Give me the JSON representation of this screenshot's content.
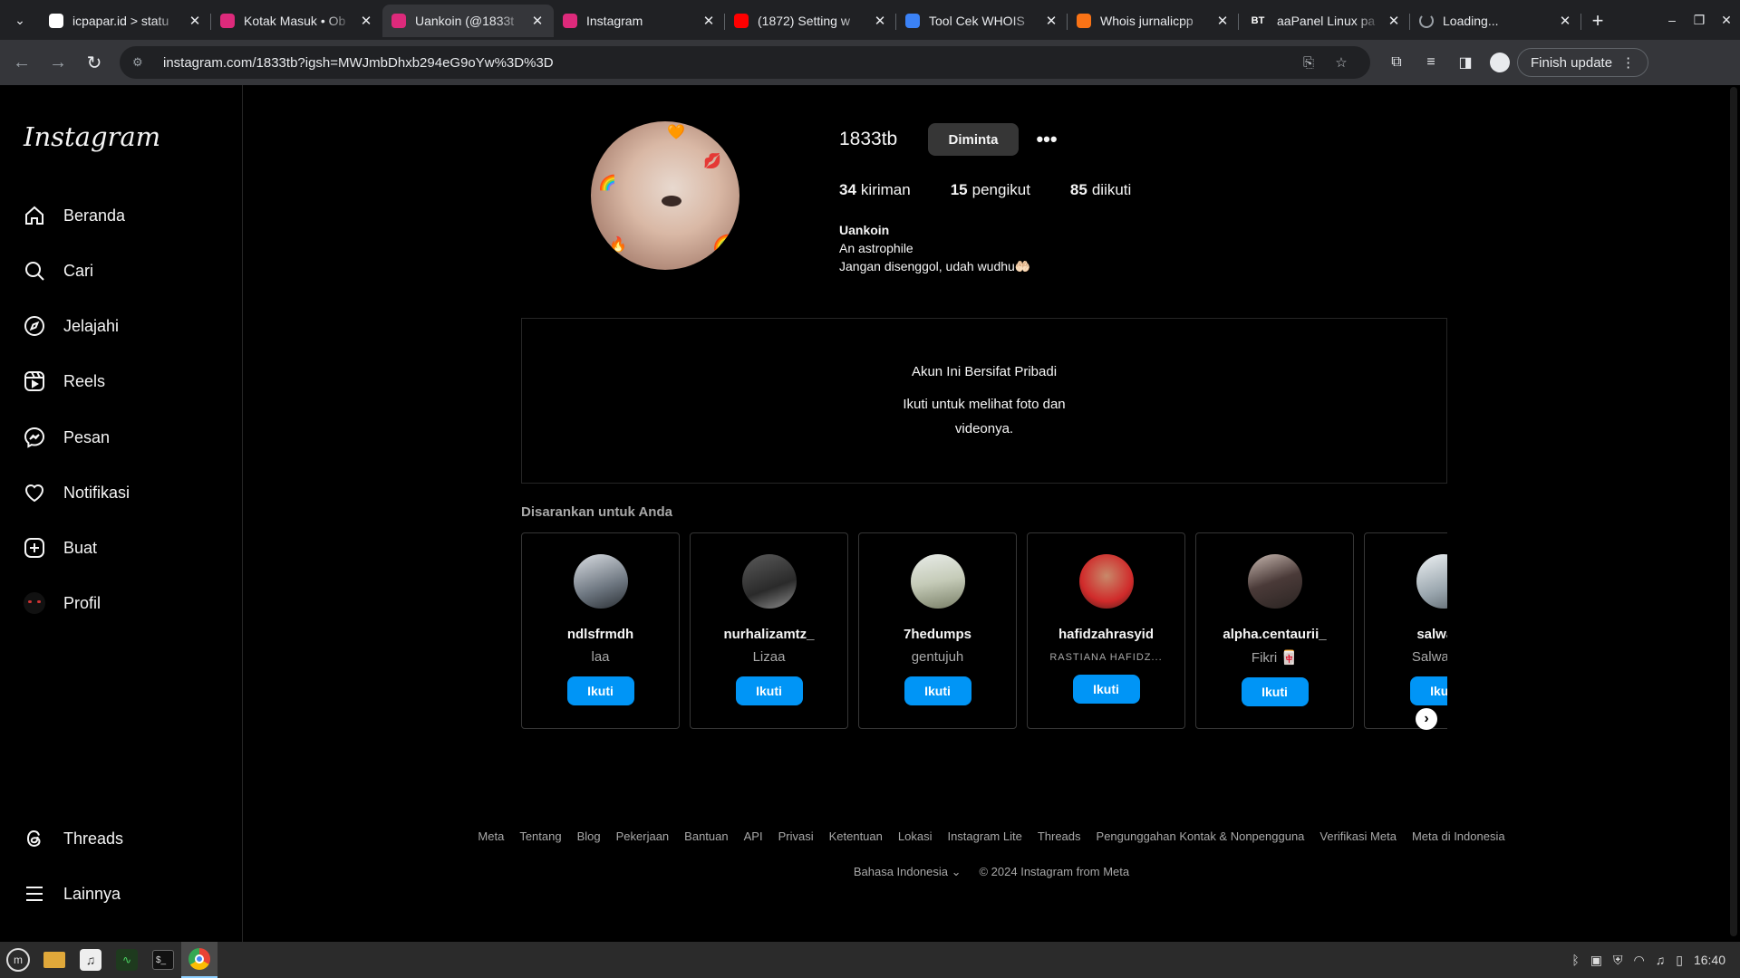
{
  "browser": {
    "tabs": [
      {
        "title": "icpapar.id > statu",
        "favicon": "globe-icon",
        "fav_color": "#ffffff",
        "active": false
      },
      {
        "title": "Kotak Masuk • Ob",
        "favicon": "instagram-icon",
        "fav_color": "#dd2a7b",
        "active": false
      },
      {
        "title": "Uankoin (@1833t",
        "favicon": "instagram-icon",
        "fav_color": "#dd2a7b",
        "active": true
      },
      {
        "title": "Instagram",
        "favicon": "instagram-icon",
        "fav_color": "#dd2a7b",
        "active": false
      },
      {
        "title": "(1872) Setting w",
        "favicon": "youtube-icon",
        "fav_color": "#ff0000",
        "active": false
      },
      {
        "title": "Tool Cek WHOIS",
        "favicon": "whois-icon",
        "fav_color": "#3b82f6",
        "active": false
      },
      {
        "title": "Whois jurnalicpp",
        "favicon": "whois-icon",
        "fav_color": "#f97316",
        "active": false
      },
      {
        "title": "aaPanel Linux pa",
        "favicon": "aapanel-icon",
        "fav_color": "#202124",
        "fav_text": "BT",
        "active": false
      },
      {
        "title": "Loading...",
        "favicon": "loading-icon",
        "fav_color": "#9aa0a6",
        "active": false
      }
    ],
    "url": "instagram.com/1833tb?igsh=MWJmbDhxb294eG9oYw%3D%3D",
    "finish_update_label": "Finish update"
  },
  "sidebar": {
    "logo": "Instagram",
    "items": [
      {
        "label": "Beranda",
        "icon": "home-icon"
      },
      {
        "label": "Cari",
        "icon": "search-icon"
      },
      {
        "label": "Jelajahi",
        "icon": "compass-icon"
      },
      {
        "label": "Reels",
        "icon": "reels-icon"
      },
      {
        "label": "Pesan",
        "icon": "messenger-icon"
      },
      {
        "label": "Notifikasi",
        "icon": "heart-icon"
      },
      {
        "label": "Buat",
        "icon": "plus-square-icon"
      },
      {
        "label": "Profil",
        "icon": "profile-avatar-icon"
      }
    ],
    "bottom_items": [
      {
        "label": "Threads",
        "icon": "threads-icon"
      },
      {
        "label": "Lainnya",
        "icon": "menu-icon"
      }
    ]
  },
  "profile": {
    "username": "1833tb",
    "requested_label": "Diminta",
    "more_label": "•••",
    "stats": {
      "posts": {
        "count": "34",
        "label": "kiriman"
      },
      "followers": {
        "count": "15",
        "label": "pengikut"
      },
      "following": {
        "count": "85",
        "label": "diikuti"
      }
    },
    "bio": {
      "name": "Uankoin",
      "line1": "An astrophile",
      "line2": "Jangan disenggol, udah wudhu🤲🏻"
    }
  },
  "private": {
    "title": "Akun Ini Bersifat Pribadi",
    "desc": "Ikuti untuk melihat foto dan videonya."
  },
  "suggestions": {
    "title": "Disarankan untuk Anda",
    "follow_label": "Ikuti",
    "cards": [
      {
        "username": "ndlsfrmdh",
        "name": "laa",
        "avatar": "linear-gradient(160deg,#d9dde2,#6d7680 60%,#2b3035)"
      },
      {
        "username": "nurhalizamtz_",
        "name": "Lizaa",
        "avatar": "linear-gradient(160deg,#5a5a5a,#2a2a2a 60%,#8d8d8d)"
      },
      {
        "username": "7hedumps",
        "name": "gentujuh",
        "avatar": "linear-gradient(170deg,#e8ece8,#c5cbb8 50%,#7a8068)"
      },
      {
        "username": "hafidzahrasyid",
        "name": "RASTIANA HAFIDZ...",
        "small": true,
        "avatar": "radial-gradient(circle at 50% 40%,#c8896a,#d02a2a 60%,#3a1f1a)"
      },
      {
        "username": "alpha.centaurii_",
        "name": "Fikri 🀄",
        "avatar": "linear-gradient(160deg,#c8b8b0,#4a3a38 50%,#2a2422)"
      },
      {
        "username": "salwana",
        "name": "Salwa Mal",
        "avatar": "linear-gradient(160deg,#eef2f4,#9aa6ae 60%,#5a646b)"
      }
    ]
  },
  "footer": {
    "links": [
      "Meta",
      "Tentang",
      "Blog",
      "Pekerjaan",
      "Bantuan",
      "API",
      "Privasi",
      "Ketentuan",
      "Lokasi",
      "Instagram Lite",
      "Threads",
      "Pengunggahan Kontak & Nonpengguna",
      "Verifikasi Meta",
      "Meta di Indonesia"
    ],
    "language": "Bahasa Indonesia",
    "copyright": "© 2024 Instagram from Meta"
  },
  "taskbar": {
    "time": "16:40"
  }
}
